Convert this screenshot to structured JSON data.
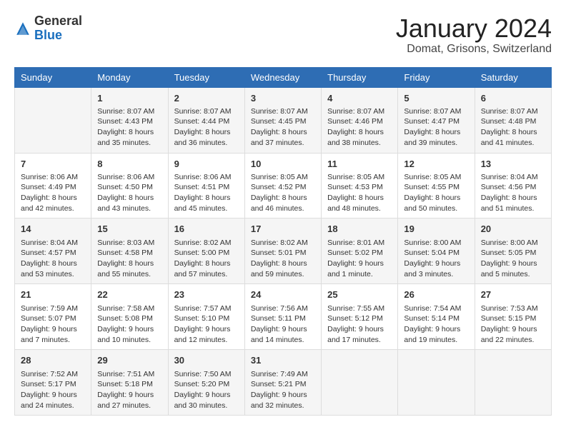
{
  "logo": {
    "general": "General",
    "blue": "Blue"
  },
  "header": {
    "month": "January 2024",
    "location": "Domat, Grisons, Switzerland"
  },
  "weekdays": [
    "Sunday",
    "Monday",
    "Tuesday",
    "Wednesday",
    "Thursday",
    "Friday",
    "Saturday"
  ],
  "weeks": [
    [
      {
        "day": "",
        "info": ""
      },
      {
        "day": "1",
        "info": "Sunrise: 8:07 AM\nSunset: 4:43 PM\nDaylight: 8 hours\nand 35 minutes."
      },
      {
        "day": "2",
        "info": "Sunrise: 8:07 AM\nSunset: 4:44 PM\nDaylight: 8 hours\nand 36 minutes."
      },
      {
        "day": "3",
        "info": "Sunrise: 8:07 AM\nSunset: 4:45 PM\nDaylight: 8 hours\nand 37 minutes."
      },
      {
        "day": "4",
        "info": "Sunrise: 8:07 AM\nSunset: 4:46 PM\nDaylight: 8 hours\nand 38 minutes."
      },
      {
        "day": "5",
        "info": "Sunrise: 8:07 AM\nSunset: 4:47 PM\nDaylight: 8 hours\nand 39 minutes."
      },
      {
        "day": "6",
        "info": "Sunrise: 8:07 AM\nSunset: 4:48 PM\nDaylight: 8 hours\nand 41 minutes."
      }
    ],
    [
      {
        "day": "7",
        "info": "Sunrise: 8:06 AM\nSunset: 4:49 PM\nDaylight: 8 hours\nand 42 minutes."
      },
      {
        "day": "8",
        "info": "Sunrise: 8:06 AM\nSunset: 4:50 PM\nDaylight: 8 hours\nand 43 minutes."
      },
      {
        "day": "9",
        "info": "Sunrise: 8:06 AM\nSunset: 4:51 PM\nDaylight: 8 hours\nand 45 minutes."
      },
      {
        "day": "10",
        "info": "Sunrise: 8:05 AM\nSunset: 4:52 PM\nDaylight: 8 hours\nand 46 minutes."
      },
      {
        "day": "11",
        "info": "Sunrise: 8:05 AM\nSunset: 4:53 PM\nDaylight: 8 hours\nand 48 minutes."
      },
      {
        "day": "12",
        "info": "Sunrise: 8:05 AM\nSunset: 4:55 PM\nDaylight: 8 hours\nand 50 minutes."
      },
      {
        "day": "13",
        "info": "Sunrise: 8:04 AM\nSunset: 4:56 PM\nDaylight: 8 hours\nand 51 minutes."
      }
    ],
    [
      {
        "day": "14",
        "info": "Sunrise: 8:04 AM\nSunset: 4:57 PM\nDaylight: 8 hours\nand 53 minutes."
      },
      {
        "day": "15",
        "info": "Sunrise: 8:03 AM\nSunset: 4:58 PM\nDaylight: 8 hours\nand 55 minutes."
      },
      {
        "day": "16",
        "info": "Sunrise: 8:02 AM\nSunset: 5:00 PM\nDaylight: 8 hours\nand 57 minutes."
      },
      {
        "day": "17",
        "info": "Sunrise: 8:02 AM\nSunset: 5:01 PM\nDaylight: 8 hours\nand 59 minutes."
      },
      {
        "day": "18",
        "info": "Sunrise: 8:01 AM\nSunset: 5:02 PM\nDaylight: 9 hours\nand 1 minute."
      },
      {
        "day": "19",
        "info": "Sunrise: 8:00 AM\nSunset: 5:04 PM\nDaylight: 9 hours\nand 3 minutes."
      },
      {
        "day": "20",
        "info": "Sunrise: 8:00 AM\nSunset: 5:05 PM\nDaylight: 9 hours\nand 5 minutes."
      }
    ],
    [
      {
        "day": "21",
        "info": "Sunrise: 7:59 AM\nSunset: 5:07 PM\nDaylight: 9 hours\nand 7 minutes."
      },
      {
        "day": "22",
        "info": "Sunrise: 7:58 AM\nSunset: 5:08 PM\nDaylight: 9 hours\nand 10 minutes."
      },
      {
        "day": "23",
        "info": "Sunrise: 7:57 AM\nSunset: 5:10 PM\nDaylight: 9 hours\nand 12 minutes."
      },
      {
        "day": "24",
        "info": "Sunrise: 7:56 AM\nSunset: 5:11 PM\nDaylight: 9 hours\nand 14 minutes."
      },
      {
        "day": "25",
        "info": "Sunrise: 7:55 AM\nSunset: 5:12 PM\nDaylight: 9 hours\nand 17 minutes."
      },
      {
        "day": "26",
        "info": "Sunrise: 7:54 AM\nSunset: 5:14 PM\nDaylight: 9 hours\nand 19 minutes."
      },
      {
        "day": "27",
        "info": "Sunrise: 7:53 AM\nSunset: 5:15 PM\nDaylight: 9 hours\nand 22 minutes."
      }
    ],
    [
      {
        "day": "28",
        "info": "Sunrise: 7:52 AM\nSunset: 5:17 PM\nDaylight: 9 hours\nand 24 minutes."
      },
      {
        "day": "29",
        "info": "Sunrise: 7:51 AM\nSunset: 5:18 PM\nDaylight: 9 hours\nand 27 minutes."
      },
      {
        "day": "30",
        "info": "Sunrise: 7:50 AM\nSunset: 5:20 PM\nDaylight: 9 hours\nand 30 minutes."
      },
      {
        "day": "31",
        "info": "Sunrise: 7:49 AM\nSunset: 5:21 PM\nDaylight: 9 hours\nand 32 minutes."
      },
      {
        "day": "",
        "info": ""
      },
      {
        "day": "",
        "info": ""
      },
      {
        "day": "",
        "info": ""
      }
    ]
  ]
}
